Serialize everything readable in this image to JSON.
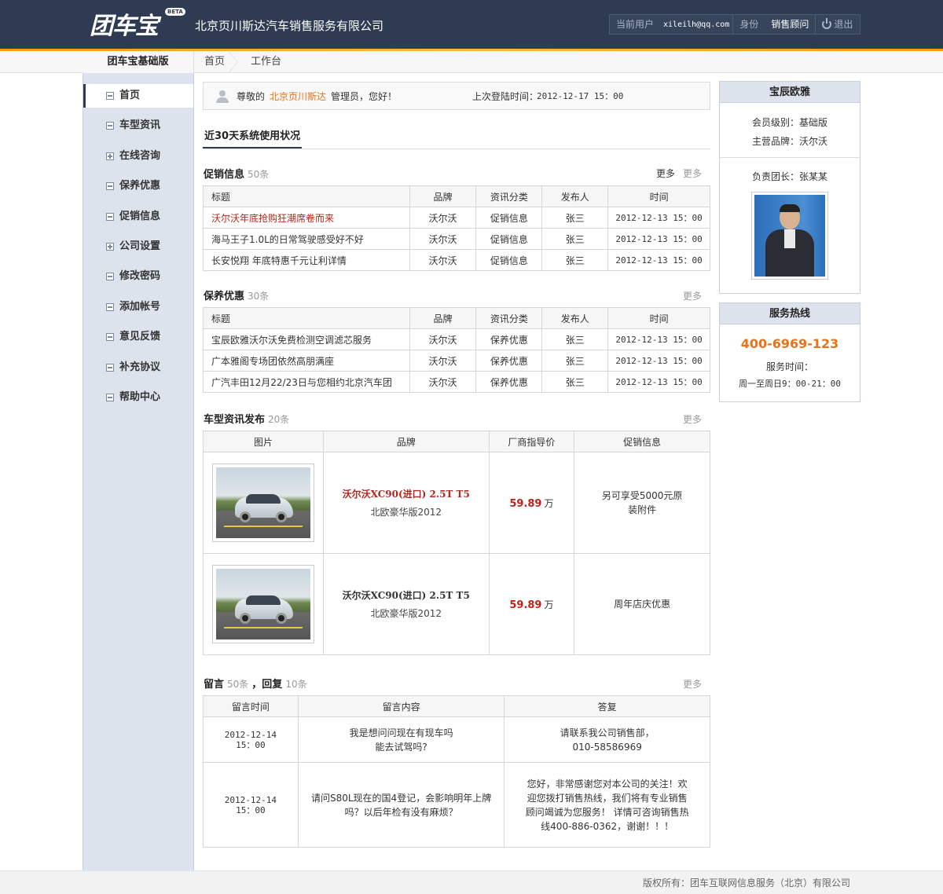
{
  "header": {
    "logo_text": "团车宝",
    "logo_badge": "BETA",
    "company": "北京页川斯达汽车销售服务有限公司",
    "user": {
      "current_user_label": "当前用户",
      "email": "xileilh@qq.com",
      "identity_label": "身份",
      "role": "销售顾问",
      "logout_label": "退出"
    }
  },
  "subnav": {
    "title": "团车宝基础版",
    "crumbs": [
      "首页",
      "工作台"
    ]
  },
  "sidebar": {
    "items": [
      {
        "label": "首页",
        "icon": "minus-box-icon",
        "active": true
      },
      {
        "label": "车型资讯",
        "icon": "minus-box-icon"
      },
      {
        "label": "在线咨询",
        "icon": "plus-box-icon"
      },
      {
        "label": "保养优惠",
        "icon": "minus-box-icon"
      },
      {
        "label": "促销信息",
        "icon": "minus-box-icon"
      },
      {
        "label": "公司设置",
        "icon": "plus-box-icon"
      },
      {
        "label": "修改密码",
        "icon": "minus-box-icon"
      },
      {
        "label": "添加帐号",
        "icon": "minus-box-icon"
      },
      {
        "label": "意见反馈",
        "icon": "minus-box-icon"
      },
      {
        "label": "补充协议",
        "icon": "minus-box-icon"
      },
      {
        "label": "帮助中心",
        "icon": "minus-box-icon"
      }
    ]
  },
  "welcome": {
    "greeting": "尊敬的",
    "company_short": "北京页川斯达",
    "role_greeting": "管理员，您好！",
    "last_login_label": "上次登陆时间：",
    "last_login_time": "2012-12-17  15：00"
  },
  "usage_title": "近30天系统使用状况",
  "promo": {
    "title": "促销信息",
    "count": "50条",
    "more_dark": "更多",
    "more": "更多",
    "headers": [
      "标题",
      "品牌",
      "资讯分类",
      "发布人",
      "时间"
    ],
    "rows": [
      {
        "title": "沃尔沃年底抢购狂潮席卷而来",
        "brand": "沃尔沃",
        "category": "促销信息",
        "publisher": "张三",
        "time": "2012-12-13 15：00",
        "highlight": true
      },
      {
        "title": "海马王子1.0L的日常驾驶感受好不好",
        "brand": "沃尔沃",
        "category": "促销信息",
        "publisher": "张三",
        "time": "2012-12-13 15：00"
      },
      {
        "title": "长安悦翔 年底特惠千元让利详情",
        "brand": "沃尔沃",
        "category": "促销信息",
        "publisher": "张三",
        "time": "2012-12-13 15：00"
      }
    ]
  },
  "maintenance": {
    "title": "保养优惠",
    "count": "30条",
    "more": "更多",
    "headers": [
      "标题",
      "品牌",
      "资讯分类",
      "发布人",
      "时间"
    ],
    "rows": [
      {
        "title": "宝辰欧雅沃尔沃免费检测空调滤芯服务",
        "brand": "沃尔沃",
        "category": "保养优惠",
        "publisher": "张三",
        "time": "2012-12-13 15：00"
      },
      {
        "title": "广本雅阁专场团依然高朋满座",
        "brand": "沃尔沃",
        "category": "保养优惠",
        "publisher": "张三",
        "time": "2012-12-13 15：00"
      },
      {
        "title": "广汽丰田12月22/23日与您相约北京汽车团",
        "brand": "沃尔沃",
        "category": "保养优惠",
        "publisher": "张三",
        "time": "2012-12-13 15：00"
      }
    ]
  },
  "models": {
    "title": "车型资讯发布",
    "count": "20条",
    "more": "更多",
    "headers": [
      "图片",
      "品牌",
      "厂商指导价",
      "促销信息"
    ],
    "rows": [
      {
        "name": "沃尔沃XC90(进口) 2.5T T5",
        "sub": "北欧豪华版2012",
        "price": "59.89",
        "unit": "万",
        "promo": "另可享受5000元原\n装附件",
        "red": true
      },
      {
        "name": "沃尔沃XC90(进口) 2.5T T5",
        "sub": "北欧豪华版2012",
        "price": "59.89",
        "unit": "万",
        "promo": "周年店庆优惠",
        "red": false
      }
    ]
  },
  "messages": {
    "title": "留言",
    "count": "50条",
    "reply_title": "，回复",
    "reply_count": "10条",
    "more": "更多",
    "headers": [
      "留言时间",
      "留言内容",
      "答复"
    ],
    "rows": [
      {
        "time": "2012-12-14\n15：00",
        "content": "我是想问问现在有现车吗\n能去试驾吗?",
        "reply": "请联系我公司销售部，\n010-58586969"
      },
      {
        "time": "2012-12-14\n15：00",
        "content": "请问S80L现在的国4登记，会影响明年上牌\n吗？以后年检有没有麻烦？",
        "reply": "您好，非常感谢您对本公司的关注！欢\n迎您拨打销售热线，我们将有专业销售\n顾问竭诚为您服务！ 详情可咨询销售热\n线400-886-0362，谢谢！！！"
      }
    ]
  },
  "dealer": {
    "name": "宝辰欧雅",
    "member_level": "会员级别：基础版",
    "main_brand": "主营品牌：沃尔沃",
    "leader": "负责团长：张某某"
  },
  "service": {
    "title": "服务热线",
    "phone": "400-6969-123",
    "hours_label": "服务时间：",
    "hours": "周一至周日9：00-21：00"
  },
  "footer": {
    "copyright": "版权所有：团车互联网信息服务（北京）有限公司"
  },
  "colors": {
    "header_bg": "#2e3b52",
    "accent_orange": "#e8731a",
    "highlight_red": "#b3261e",
    "sidebar_bg": "#dde3ed"
  }
}
